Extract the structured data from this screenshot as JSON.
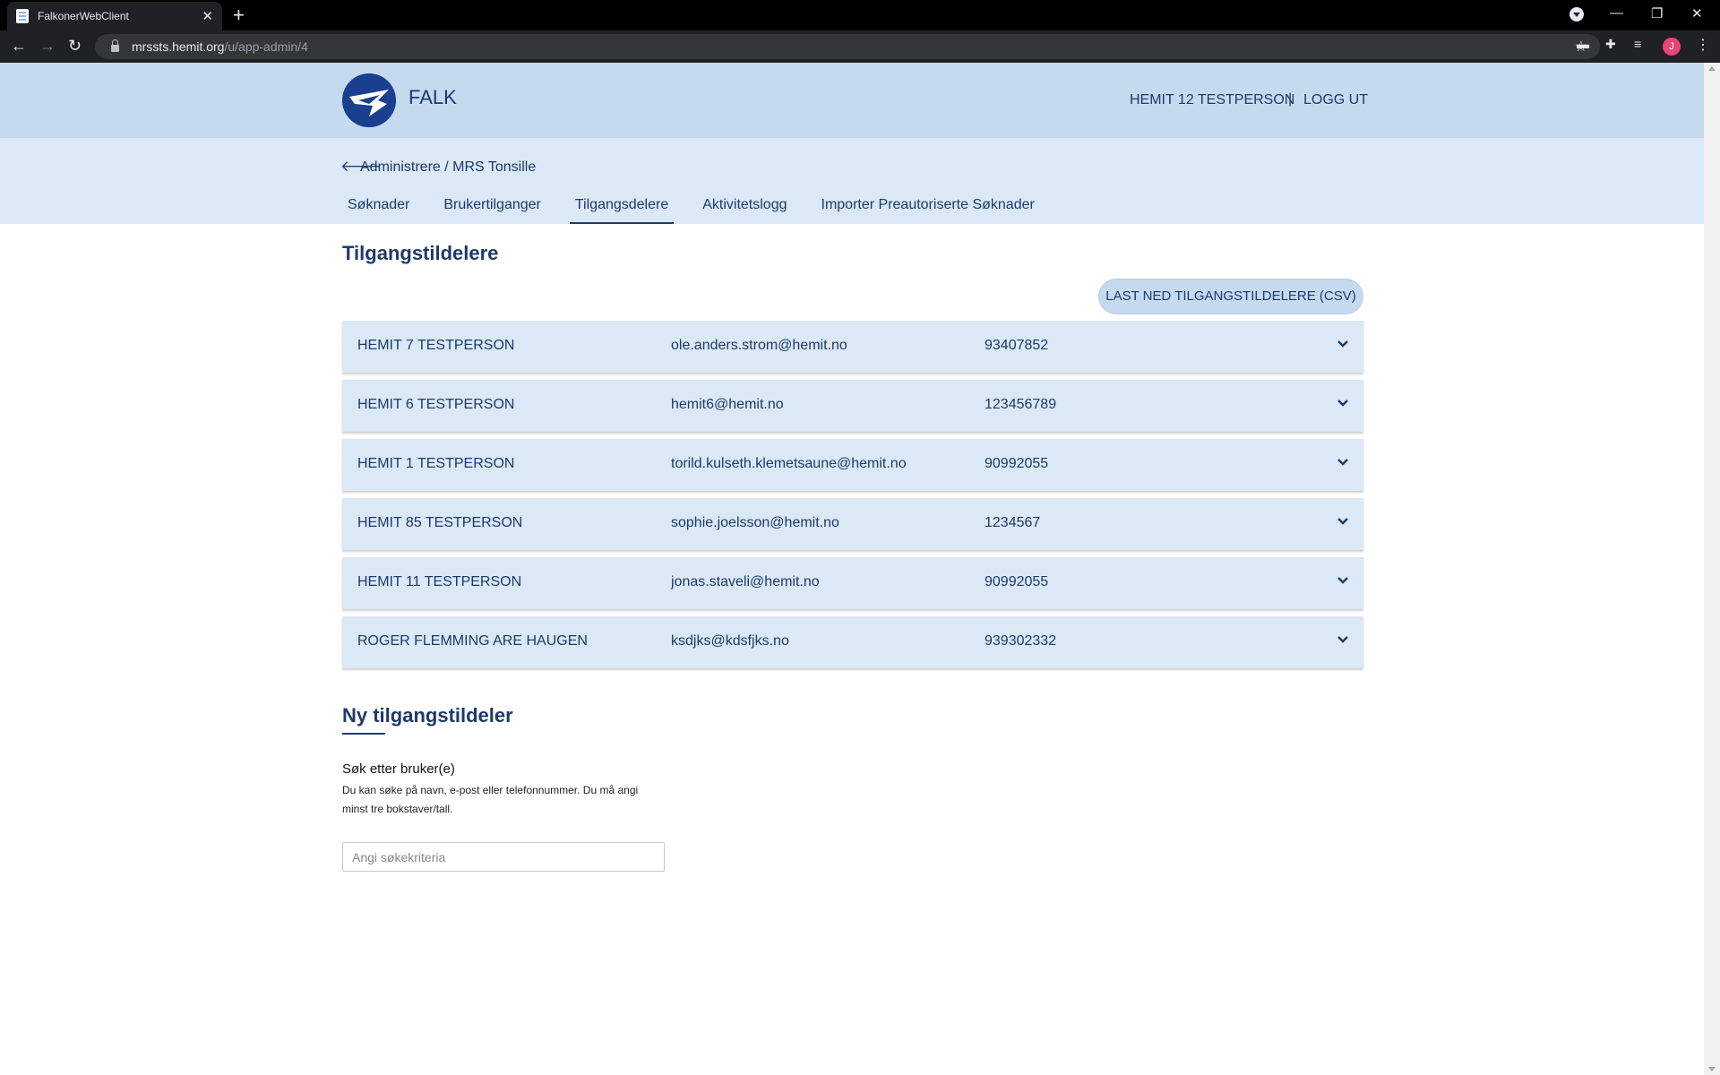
{
  "browser": {
    "tab_title": "FalkonerWebClient",
    "url_host": "mrssts.hemit.org",
    "url_path": "/u/app-admin/4",
    "avatar_letter": "J"
  },
  "header": {
    "brand": "FALK",
    "user_name": "HEMIT 12 TESTPERSON",
    "separator": "|",
    "logout_label": "LOGG UT"
  },
  "subheader": {
    "breadcrumb": "Administrere / MRS Tonsille",
    "tabs": [
      {
        "label": "Søknader"
      },
      {
        "label": "Brukertilganger"
      },
      {
        "label": "Tilgangsdelere"
      },
      {
        "label": "Aktivitetslogg"
      },
      {
        "label": "Importer Preautoriserte Søknader"
      }
    ],
    "active_tab": "Tilgangsdelere"
  },
  "main": {
    "title": "Tilgangstildelere",
    "download_button": "LAST NED TILGANGSTILDELERE (CSV)",
    "rows": [
      {
        "name": "HEMIT 7 TESTPERSON",
        "email": "ole.anders.strom@hemit.no",
        "phone": "93407852"
      },
      {
        "name": "HEMIT 6 TESTPERSON",
        "email": "hemit6@hemit.no",
        "phone": "123456789"
      },
      {
        "name": "HEMIT 1 TESTPERSON",
        "email": "torild.kulseth.klemetsaune@hemit.no",
        "phone": "90992055"
      },
      {
        "name": "HEMIT 85 TESTPERSON",
        "email": "sophie.joelsson@hemit.no",
        "phone": "1234567"
      },
      {
        "name": "HEMIT 11 TESTPERSON",
        "email": "jonas.staveli@hemit.no",
        "phone": "90992055"
      },
      {
        "name": "ROGER FLEMMING ARE HAUGEN",
        "email": "ksdjks@kdsfjks.no",
        "phone": "939302332"
      }
    ]
  },
  "new_section": {
    "title": "Ny tilgangstildeler",
    "search_label": "Søk etter bruker(e)",
    "search_help": "Du kan søke på navn, e-post eller telefonnummer. Du må angi minst tre bokstaver/tall.",
    "search_placeholder": "Angi søkekriteria",
    "search_value": ""
  },
  "colors": {
    "header_bg": "#c5daef",
    "subheader_bg": "#dbe8f5",
    "text": "#1d3a6b"
  }
}
